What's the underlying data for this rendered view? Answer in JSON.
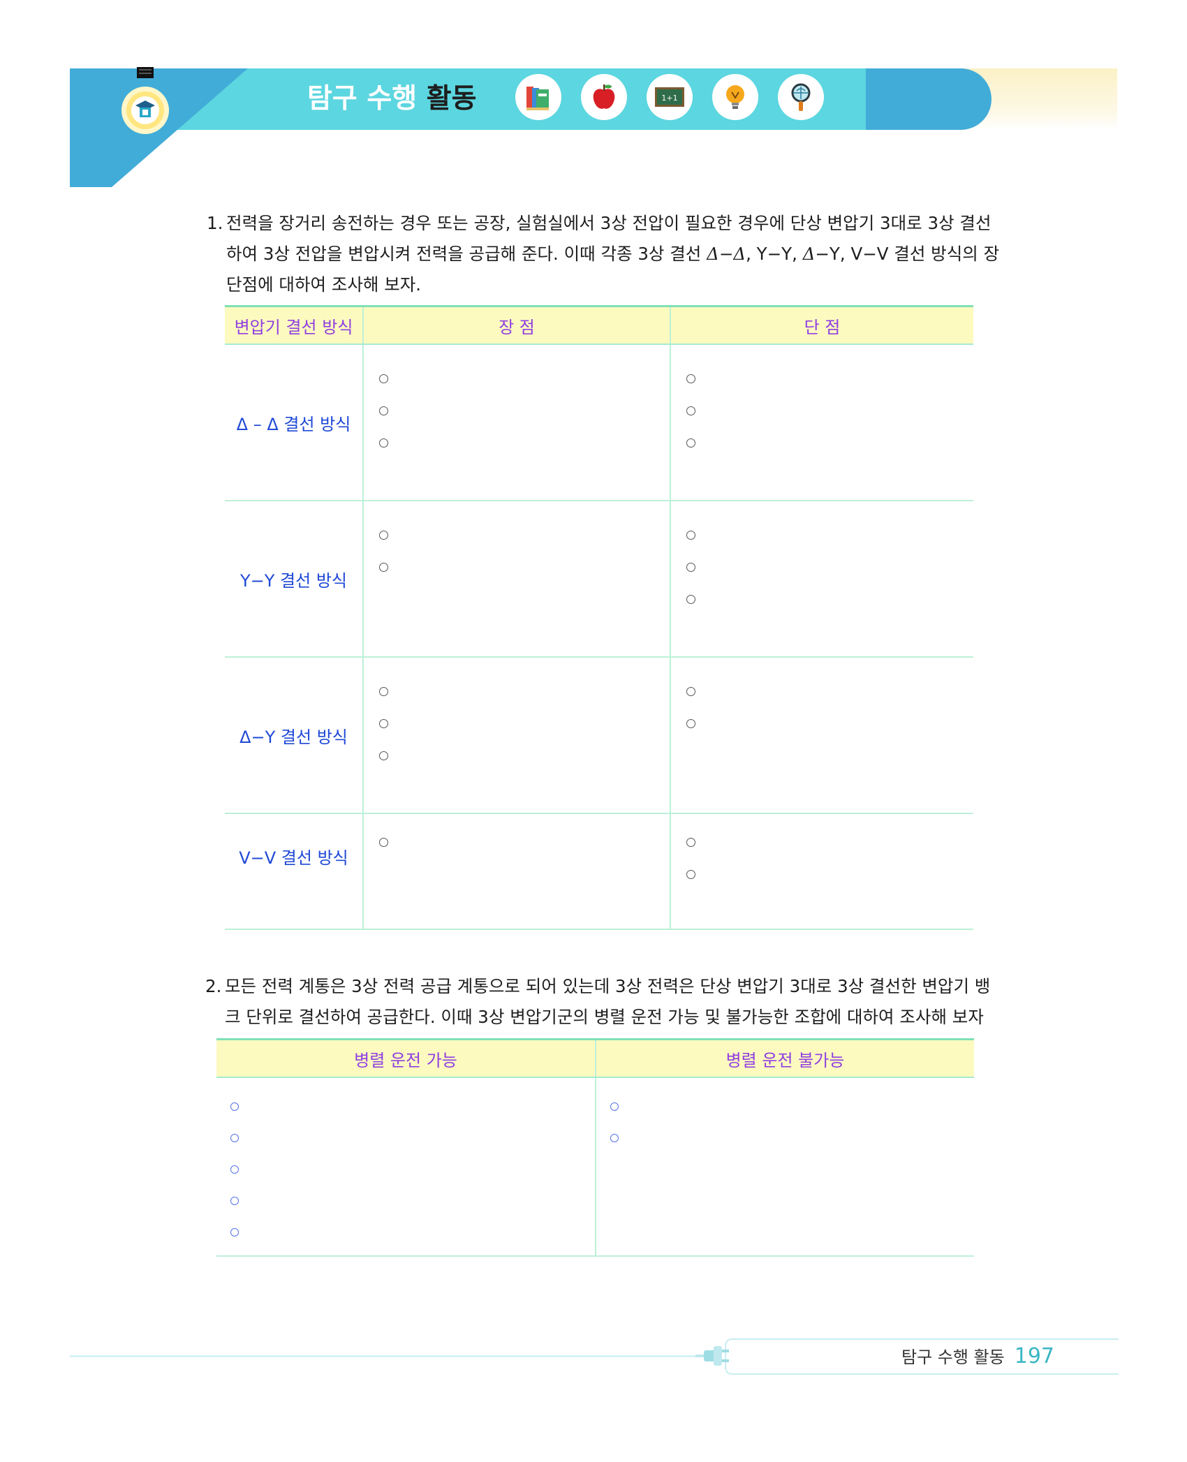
{
  "header": {
    "title_light": "탐구 수행",
    "title_bold": "활동",
    "icons": [
      "graduation-bulb-icon",
      "books-icon",
      "apple-icon",
      "chalkboard-icon",
      "lightbulb-icon",
      "magnifier-icon"
    ],
    "chalkboard_text": "1+1",
    "colors": {
      "teal": "#5cd6e0",
      "blue": "#42acd8",
      "cream": "#fbf1c6"
    }
  },
  "q1": {
    "number": "1.",
    "line1": "전력을 장거리 송전하는 경우 또는 공장, 실험실에서 3상 전압이 필요한 경우에 단상 변압기 3대로 3상 결선",
    "line2_a": "하여 3상 전압을 변압시켜 전력을 공급해 준다. 이때  각종 3상 결선 ",
    "line2_delta1": "Δ−Δ",
    "line2_b": ", Y−Y, ",
    "line2_delta2": "Δ",
    "line2_c": "−Y, V−V 결선 방식의 장",
    "line3": "단점에 대하여 조사해 보자."
  },
  "table1": {
    "headers": [
      "변압기 결선 방식",
      "장 점",
      "단 점"
    ],
    "rows": [
      {
        "label": "Δ – Δ 결선 방식",
        "pros": 3,
        "cons": 3
      },
      {
        "label": "Y−Y 결선 방식",
        "pros": 2,
        "cons": 3
      },
      {
        "label": "Δ−Y 결선 방식",
        "pros": 3,
        "cons": 2
      },
      {
        "label": "V−V 결선 방식",
        "pros": 1,
        "cons": 2
      }
    ]
  },
  "q2": {
    "number": "2.",
    "line1": "모든 전력 계통은 3상 전력 공급 계통으로 되어 있는데 3상 전력은 단상 변압기 3대로 3상 결선한 변압기 뱅",
    "line2": "크 단위로 결선하여 공급한다. 이때 3상 변압기군의 병렬 운전 가능 및 불가능한 조합에 대하여 조사해 보자"
  },
  "table2": {
    "headers": [
      "병렬 운전 가능",
      "병렬 운전 불가능"
    ],
    "possible_count": 5,
    "impossible_count": 2
  },
  "footer": {
    "label": "탐구 수행 활동",
    "page": "197"
  }
}
